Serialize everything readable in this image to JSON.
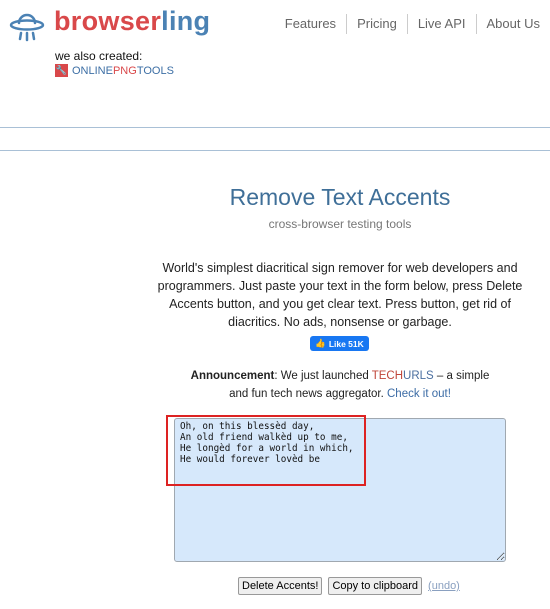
{
  "brand": {
    "part1": "browser",
    "part2": "ling",
    "also_created": "we also created:",
    "partner": {
      "part1": "ONLINE",
      "part2": "PNG",
      "part3": "TOOLS"
    }
  },
  "nav": [
    {
      "label": "Features"
    },
    {
      "label": "Pricing"
    },
    {
      "label": "Live API"
    },
    {
      "label": "About Us"
    }
  ],
  "main": {
    "title": "Remove Text Accents",
    "subtitle": "cross-browser testing tools",
    "description": "World's simplest diacritical sign remover for web developers and programmers. Just paste your text in the form below, press Delete Accents button, and you get clear text. Press button, get rid of diacritics. No ads, nonsense or garbage.",
    "like": {
      "label": "Like 51K"
    },
    "announcement": {
      "label": "Announcement",
      "text1": ": We just launched ",
      "tech1": "TECH",
      "tech2": "URLS",
      "text2": " – a simple and fun tech news aggregator. ",
      "link": "Check it out!"
    },
    "textarea_value": "Oh, on this blessèd day,\nAn old friend walkèd up to me,\nHe longèd for a world in which,\nHe would forever lovèd be",
    "buttons": {
      "delete": "Delete Accents!",
      "copy": "Copy to clipboard",
      "undo": "(undo)"
    }
  },
  "colors": {
    "brand_red": "#d9484a",
    "brand_blue": "#4b82b4",
    "textarea_bg": "#d6e8fb",
    "highlight": "#dd2222"
  }
}
